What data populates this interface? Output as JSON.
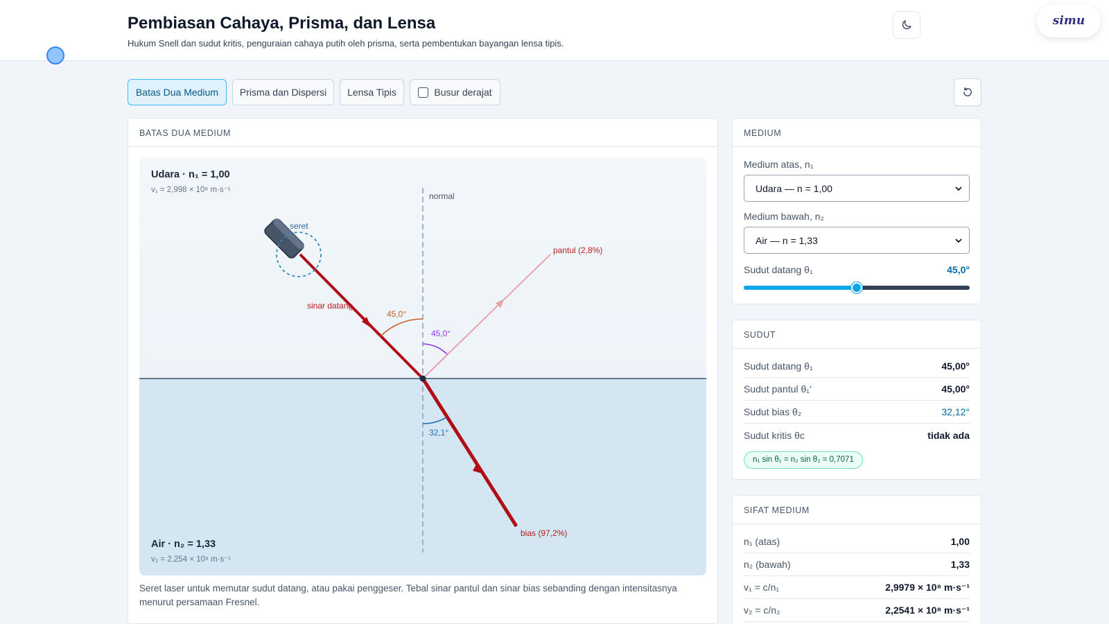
{
  "header": {
    "title": "Pembiasan Cahaya, Prisma, dan Lensa",
    "subtitle": "Hukum Snell dan sudut kritis, penguraian cahaya putih oleh prisma, serta pembentukan bayangan lensa tipis.",
    "theme_icon": "moon-icon",
    "brand": "simu"
  },
  "tabs": [
    {
      "label": "Batas Dua Medium",
      "active": true
    },
    {
      "label": "Prisma dan Dispersi",
      "active": false
    },
    {
      "label": "Lensa Tipis",
      "active": false
    }
  ],
  "protractor_toggle": {
    "label": "Busur derajat",
    "checked": false
  },
  "reset_icon": "refresh-icon",
  "sim_panel": {
    "title": "BATAS DUA MEDIUM",
    "top_medium": {
      "name": "Udara · n₁ = 1,00",
      "speed": "v₁ = 2,998 × 10⁸ m·s⁻¹"
    },
    "bottom_medium": {
      "name": "Air · n₂ = 1,33",
      "speed": "v₂ = 2,254 × 10⁸ m·s⁻¹"
    },
    "labels": {
      "normal": "normal",
      "drag": "seret",
      "incident": "sinar datang",
      "reflected": "pantul (2,8%)",
      "refracted": "bias (97,2%)",
      "incident_angle": "45,0°",
      "reflected_angle": "45,0°",
      "refracted_angle": "32,1°"
    },
    "caption": "Seret laser untuk memutar sudut datang, atau pakai penggeser. Tebal sinar pantul dan sinar bias sebanding dengan intensitasnya menurut persamaan Fresnel.",
    "colors": {
      "ray": "#b00d16",
      "reflected": "#e8a3a8",
      "incident_arc": "#c2612a",
      "reflect_arc": "#9333ea",
      "refract_arc": "#1f6fb0",
      "water": "#d3e6f2"
    }
  },
  "medium_panel": {
    "title": "MEDIUM",
    "top_label": "Medium atas, n₁",
    "top_value": "Udara — n = 1,00",
    "bottom_label": "Medium bawah, n₂",
    "bottom_value": "Air — n = 1,33",
    "angle_label": "Sudut datang θ₁",
    "angle_value": "45,0°",
    "angle_fraction": 0.5
  },
  "angles_panel": {
    "title": "SUDUT",
    "rows": [
      {
        "label": "Sudut datang θ₁",
        "value": "45,00°"
      },
      {
        "label": "Sudut pantul θ₁′",
        "value": "45,00°"
      },
      {
        "label": "Sudut bias θ₂",
        "value": "32,12°"
      },
      {
        "label": "Sudut kritis θc",
        "value": "tidak ada"
      }
    ],
    "snell": "n₁ sin θ₁ = n₂ sin θ₂ = 0,7071"
  },
  "props_panel": {
    "title": "SIFAT MEDIUM",
    "rows": [
      {
        "label": "n₁ (atas)",
        "value": "1,00"
      },
      {
        "label": "n₂ (bawah)",
        "value": "1,33"
      },
      {
        "label": "v₁ = c/n₁",
        "value": "2,9979 × 10⁸ m·s⁻¹"
      },
      {
        "label": "v₂ = c/n₂",
        "value": "2,2541 × 10⁸ m·s⁻¹"
      }
    ]
  }
}
